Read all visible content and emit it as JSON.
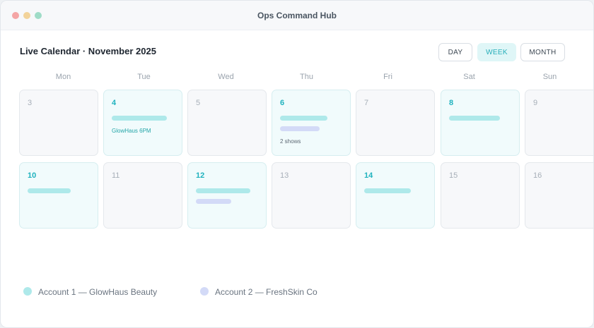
{
  "window": {
    "title": "Ops Command Hub"
  },
  "calendar": {
    "heading": "Live Calendar · November 2025",
    "views": [
      "DAY",
      "WEEK",
      "MONTH"
    ],
    "selected_view": "WEEK",
    "weekdays": [
      "Mon",
      "Tue",
      "Wed",
      "Thu",
      "Fri",
      "Sat",
      "Sun"
    ],
    "weeks": [
      {
        "days": [
          {
            "num": "3",
            "active": false
          },
          {
            "num": "4",
            "active": true,
            "events": [
              "account1"
            ],
            "note": "GlowHaus 6PM"
          },
          {
            "num": "5",
            "active": false
          },
          {
            "num": "6",
            "active": true,
            "events": [
              "account1",
              "account2"
            ],
            "note": "2 shows"
          },
          {
            "num": "7",
            "active": false
          },
          {
            "num": "8",
            "active": true,
            "events": [
              "account1"
            ]
          },
          {
            "num": "9",
            "active": false
          }
        ]
      },
      {
        "days": [
          {
            "num": "10",
            "active": true,
            "events": [
              "account1"
            ]
          },
          {
            "num": "11",
            "active": false
          },
          {
            "num": "12",
            "active": true,
            "events": [
              "account1",
              "account2"
            ]
          },
          {
            "num": "13",
            "active": false
          },
          {
            "num": "14",
            "active": true,
            "events": [
              "account1"
            ]
          },
          {
            "num": "15",
            "active": false
          },
          {
            "num": "16",
            "active": false
          }
        ]
      }
    ]
  },
  "legend": [
    {
      "label": "Account 1 — GlowHaus Beauty",
      "color": "#aee9ea"
    },
    {
      "label": "Account 2 — FreshSkin Co",
      "color": "#d3daf7"
    }
  ],
  "colors": {
    "accent": "#1fb2be",
    "account1": "#aee9ea",
    "account2": "#d3daf7"
  }
}
